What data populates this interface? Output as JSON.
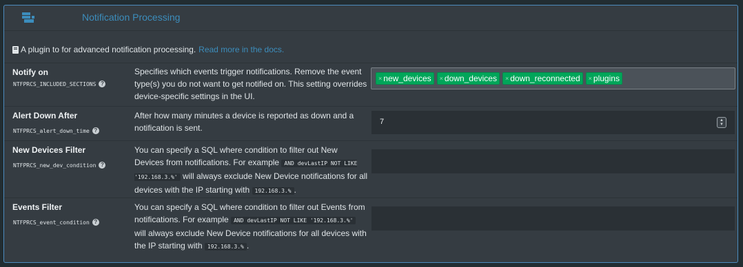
{
  "header": {
    "title": "Notification Processing",
    "icon": "plugin-icon"
  },
  "description": {
    "text": "A plugin to for advanced notification processing.",
    "link_text": "Read more in the docs."
  },
  "settings": [
    {
      "label": "Notify on",
      "code": "NTFPRCS_INCLUDED_SECTIONS",
      "description": "Specifies which events trigger notifications. Remove the event type(s) you do not want to get notified on. This setting overrides device-specific settings in the UI.",
      "tags": [
        "new_devices",
        "down_devices",
        "down_reconnected",
        "plugins"
      ]
    },
    {
      "label": "Alert Down After",
      "code": "NTFPRCS_alert_down_time",
      "description": "After how many minutes a device is reported as down and a notification is sent.",
      "value": "7"
    },
    {
      "label": "New Devices Filter",
      "code": "NTFPRCS_new_dev_condition",
      "desc_part1": "You can specify a SQL where condition to filter out New Devices from notifications. For example",
      "sql_example": "AND devLastIP NOT LIKE '192.168.3.%'",
      "desc_part2": "will always exclude New Device notifications for all devices with the IP starting with",
      "ip_prefix": "192.168.3.%",
      "end": ".",
      "value": ""
    },
    {
      "label": "Events Filter",
      "code": "NTFPRCS_event_condition",
      "desc_part1": "You can specify a SQL where condition to filter out Events from notifications. For example",
      "sql_example": "AND devLastIP NOT LIKE '192.168.3.%'",
      "desc_part2": "will always exclude New Device notifications for all devices with the IP starting with",
      "ip_prefix": "192.168.3.%",
      "end": ".",
      "value": ""
    }
  ],
  "help_glyph": "?",
  "tag_remove_glyph": "×",
  "colors": {
    "accent": "#3c8dbc",
    "tag": "#00a65a",
    "panel": "#353c42",
    "input": "#2a3035"
  }
}
